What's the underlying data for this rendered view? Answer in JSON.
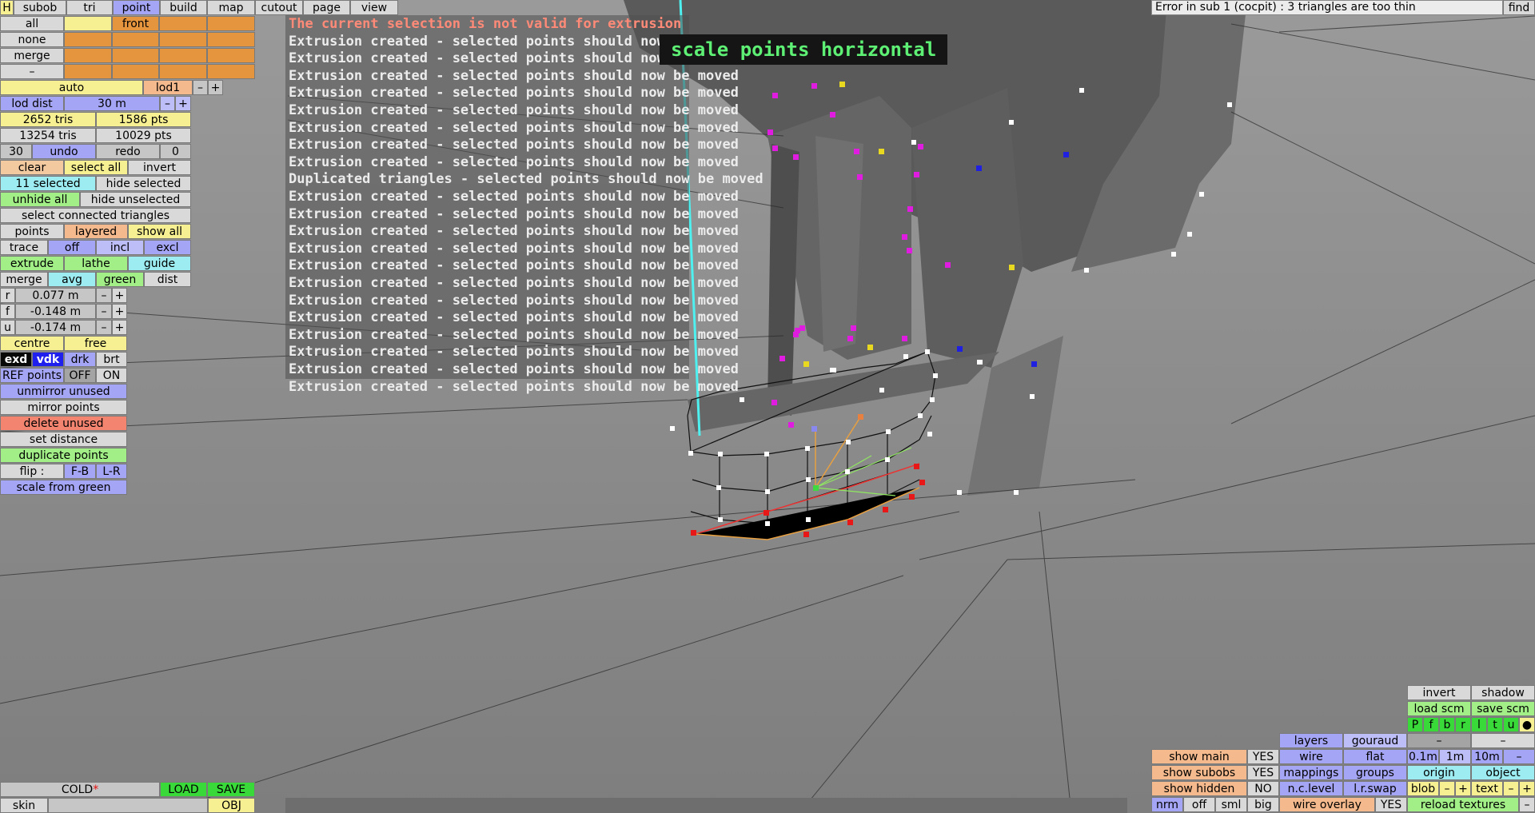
{
  "menu": {
    "h": "H",
    "subob": "subob",
    "tri": "tri",
    "point": "point",
    "build": "build",
    "map": "map",
    "cutout": "cutout",
    "page": "page",
    "view": "view"
  },
  "left": {
    "all": "all",
    "front": "front",
    "none": "none",
    "merge_top": "merge",
    "dash": "–",
    "auto": "auto",
    "lod1": "lod1",
    "minus": "–",
    "plus": "+",
    "lod_dist": "lod dist",
    "lod_value": "30 m",
    "tris1": "2652 tris",
    "pts1": "1586 pts",
    "tris2": "13254 tris",
    "pts2": "10029 pts",
    "undo_count": "30",
    "undo": "undo",
    "redo": "redo",
    "redo_count": "0",
    "clear": "clear",
    "select_all": "select all",
    "invert": "invert",
    "selected": "11 selected",
    "hide_selected": "hide selected",
    "unhide_all": "unhide all",
    "hide_unselected": "hide unselected",
    "select_connected": "select connected triangles",
    "points": "points",
    "layered": "layered",
    "show_all": "show all",
    "trace": "trace",
    "off": "off",
    "incl": "incl",
    "excl": "excl",
    "extrude": "extrude",
    "lathe": "lathe",
    "guide": "guide",
    "merge": "merge",
    "avg": "avg",
    "green": "green",
    "dist": "dist",
    "r_label": "r",
    "r_value": "0.077 m",
    "f_label": "f",
    "f_value": "-0.148 m",
    "u_label": "u",
    "u_value": "-0.174 m",
    "centre": "centre",
    "free": "free",
    "exd": "exd",
    "vdk": "vdk",
    "drk": "drk",
    "brt": "brt",
    "ref_points": "REF points",
    "ref_off": "OFF",
    "ref_on": "ON",
    "unmirror_unused": "unmirror unused",
    "mirror_points": "mirror points",
    "delete_unused": "delete unused",
    "set_distance": "set distance",
    "duplicate_points": "duplicate points",
    "flip": "flip :",
    "fb": "F-B",
    "lr": "L-R",
    "scale_from_green": "scale from green"
  },
  "messages": [
    "The current selection is not valid for extrusion",
    "Extrusion created - selected points should now be moved",
    "Extrusion created - selected points should now be moved",
    "Extrusion created - selected points should now be moved",
    "Extrusion created - selected points should now be moved",
    "Extrusion created - selected points should now be moved",
    "Extrusion created - selected points should now be moved",
    "Extrusion created - selected points should now be moved",
    "Extrusion created - selected points should now be moved",
    "Duplicated triangles - selected points should now be moved",
    "Extrusion created - selected points should now be moved",
    "Extrusion created - selected points should now be moved",
    "Extrusion created - selected points should now be moved",
    "Extrusion created - selected points should now be moved",
    "Extrusion created - selected points should now be moved",
    "Extrusion created - selected points should now be moved",
    "Extrusion created - selected points should now be moved",
    "Extrusion created - selected points should now be moved",
    "Extrusion created - selected points should now be moved",
    "Extrusion created - selected points should now be moved",
    "Extrusion created - selected points should now be moved",
    "Extrusion created - selected points should now be moved"
  ],
  "tooltip": "scale points horizontal",
  "error": "Error in sub 1 (cocpit) : 3 triangles are too thin",
  "find": "find",
  "bottom_left": {
    "cold": "COLD",
    "star": "*",
    "load": "LOAD",
    "save": "SAVE",
    "skin": "skin",
    "obj": "OBJ"
  },
  "bottom_right": {
    "invert": "invert",
    "shadow": "shadow",
    "load_scm": "load scm",
    "save_scm": "save scm",
    "letters": [
      "P",
      "f",
      "b",
      "r",
      "l",
      "t",
      "u"
    ],
    "dot": "●",
    "dash1": "–",
    "dash2": "–",
    "layers": "layers",
    "gouraud": "gouraud",
    "show_main": "show main",
    "yes1": "YES",
    "wire": "wire",
    "flat": "flat",
    "d01": "0.1m",
    "d1": "1m",
    "d10": "10m",
    "dminus": "–",
    "show_subobs": "show subobs",
    "yes2": "YES",
    "mappings": "mappings",
    "groups": "groups",
    "origin": "origin",
    "object": "object",
    "show_hidden": "show hidden",
    "no": "NO",
    "nc_level": "n.c.level",
    "lr_swap": "l.r.swap",
    "blob": "blob",
    "bminus": "–",
    "bplus": "+",
    "text": "text",
    "tminus": "–",
    "tplus": "+",
    "nrm": "nrm",
    "off": "off",
    "sml": "sml",
    "big": "big",
    "wire_overlay": "wire overlay",
    "yes3": "YES",
    "reload_textures": "reload textures",
    "rminus": "–"
  }
}
